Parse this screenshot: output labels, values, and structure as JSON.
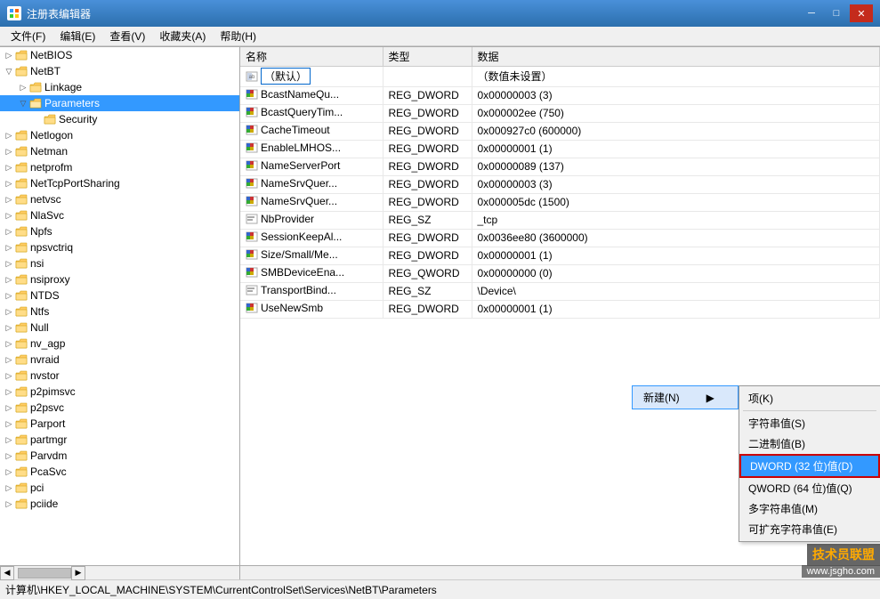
{
  "window": {
    "title": "注册表编辑器",
    "min_label": "─",
    "max_label": "□",
    "close_label": "✕"
  },
  "menu": {
    "items": [
      "文件(F)",
      "编辑(E)",
      "查看(V)",
      "收藏夹(A)",
      "帮助(H)"
    ]
  },
  "tree": {
    "items": [
      {
        "label": "NetBIOS",
        "level": 1,
        "expanded": false,
        "hasChildren": true
      },
      {
        "label": "NetBT",
        "level": 1,
        "expanded": true,
        "hasChildren": true
      },
      {
        "label": "Linkage",
        "level": 2,
        "expanded": false,
        "hasChildren": true
      },
      {
        "label": "Parameters",
        "level": 2,
        "expanded": true,
        "hasChildren": true,
        "selected": true
      },
      {
        "label": "Security",
        "level": 3,
        "expanded": false,
        "hasChildren": false
      },
      {
        "label": "Netlogon",
        "level": 1,
        "expanded": false,
        "hasChildren": true
      },
      {
        "label": "Netman",
        "level": 1,
        "expanded": false,
        "hasChildren": true
      },
      {
        "label": "netprofm",
        "level": 1,
        "expanded": false,
        "hasChildren": true
      },
      {
        "label": "NetTcpPortSharing",
        "level": 1,
        "expanded": false,
        "hasChildren": true
      },
      {
        "label": "netvsc",
        "level": 1,
        "expanded": false,
        "hasChildren": true
      },
      {
        "label": "NlaSvc",
        "level": 1,
        "expanded": false,
        "hasChildren": true
      },
      {
        "label": "Npfs",
        "level": 1,
        "expanded": false,
        "hasChildren": true
      },
      {
        "label": "npsvctriq",
        "level": 1,
        "expanded": false,
        "hasChildren": true
      },
      {
        "label": "nsi",
        "level": 1,
        "expanded": false,
        "hasChildren": true
      },
      {
        "label": "nsiproxy",
        "level": 1,
        "expanded": false,
        "hasChildren": true
      },
      {
        "label": "NTDS",
        "level": 1,
        "expanded": false,
        "hasChildren": true
      },
      {
        "label": "Ntfs",
        "level": 1,
        "expanded": false,
        "hasChildren": true
      },
      {
        "label": "Null",
        "level": 1,
        "expanded": false,
        "hasChildren": true
      },
      {
        "label": "nv_agp",
        "level": 1,
        "expanded": false,
        "hasChildren": true
      },
      {
        "label": "nvraid",
        "level": 1,
        "expanded": false,
        "hasChildren": true
      },
      {
        "label": "nvstor",
        "level": 1,
        "expanded": false,
        "hasChildren": true
      },
      {
        "label": "p2pimsvc",
        "level": 1,
        "expanded": false,
        "hasChildren": true
      },
      {
        "label": "p2psvc",
        "level": 1,
        "expanded": false,
        "hasChildren": true
      },
      {
        "label": "Parport",
        "level": 1,
        "expanded": false,
        "hasChildren": true
      },
      {
        "label": "partmgr",
        "level": 1,
        "expanded": false,
        "hasChildren": true
      },
      {
        "label": "Parvdm",
        "level": 1,
        "expanded": false,
        "hasChildren": true
      },
      {
        "label": "PcaSvc",
        "level": 1,
        "expanded": false,
        "hasChildren": true
      },
      {
        "label": "pci",
        "level": 1,
        "expanded": false,
        "hasChildren": true
      },
      {
        "label": "pciide",
        "level": 1,
        "expanded": false,
        "hasChildren": true
      }
    ]
  },
  "registry_table": {
    "columns": [
      "名称",
      "类型",
      "数据"
    ],
    "rows": [
      {
        "name": "（默认）",
        "type": "",
        "data": "（数值未设置）",
        "isDefault": true,
        "iconType": "default"
      },
      {
        "name": "BcastNameQu...",
        "type": "REG_DWORD",
        "data": "0x00000003 (3)",
        "iconType": "dword"
      },
      {
        "name": "BcastQueryTim...",
        "type": "REG_DWORD",
        "data": "0x000002ee (750)",
        "iconType": "dword"
      },
      {
        "name": "CacheTimeout",
        "type": "REG_DWORD",
        "data": "0x000927c0 (600000)",
        "iconType": "dword"
      },
      {
        "name": "EnableLMHOS...",
        "type": "REG_DWORD",
        "data": "0x00000001 (1)",
        "iconType": "dword"
      },
      {
        "name": "NameServerPort",
        "type": "REG_DWORD",
        "data": "0x00000089 (137)",
        "iconType": "dword"
      },
      {
        "name": "NameSrvQuer...",
        "type": "REG_DWORD",
        "data": "0x00000003 (3)",
        "iconType": "dword"
      },
      {
        "name": "NameSrvQuer...",
        "type": "REG_DWORD",
        "data": "0x000005dc (1500)",
        "iconType": "dword"
      },
      {
        "name": "NbProvider",
        "type": "REG_SZ",
        "data": "_tcp",
        "iconType": "sz"
      },
      {
        "name": "SessionKeepAl...",
        "type": "REG_DWORD",
        "data": "0x0036ee80 (3600000)",
        "iconType": "dword"
      },
      {
        "name": "Size/Small/Me...",
        "type": "REG_DWORD",
        "data": "0x00000001 (1)",
        "iconType": "dword"
      },
      {
        "name": "SMBDeviceEna...",
        "type": "REG_QWORD",
        "data": "0x00000000 (0)",
        "iconType": "qword"
      },
      {
        "name": "TransportBind...",
        "type": "REG_SZ",
        "data": "\\Device\\",
        "iconType": "sz"
      },
      {
        "name": "UseNewSmb",
        "type": "REG_DWORD",
        "data": "0x00000001 (1)",
        "iconType": "dword"
      }
    ]
  },
  "context_menu": {
    "trigger_label": "新建(N)",
    "trigger_arrow": "▶",
    "items": [
      {
        "label": "项(K)",
        "id": "item-k"
      },
      {
        "label": "字符串值(S)",
        "id": "string-s"
      },
      {
        "label": "二进制值(B)",
        "id": "binary-b"
      },
      {
        "label": "DWORD (32 位)值(D)",
        "id": "dword-d",
        "highlighted": true
      },
      {
        "label": "QWORD (64 位)值(Q)",
        "id": "qword-q"
      },
      {
        "label": "多字符串值(M)",
        "id": "multi-m"
      },
      {
        "label": "可扩充字符串值(E)",
        "id": "expand-e"
      }
    ]
  },
  "status_bar": {
    "text": "计算机\\HKEY_LOCAL_MACHINE\\SYSTEM\\CurrentControlSet\\Services\\NetBT\\Parameters"
  },
  "watermark": {
    "line1": "技术员联盟",
    "line2": "www.jsgho.com"
  }
}
